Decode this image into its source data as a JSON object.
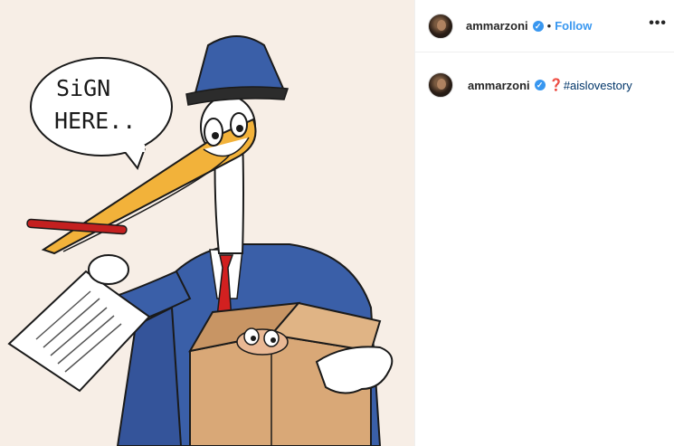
{
  "post": {
    "username": "ammarzoni",
    "follow_label": "Follow",
    "separator": "•",
    "more_label": "•••",
    "verified_glyph": "✓"
  },
  "caption": {
    "username": "ammarzoni",
    "emoji": "❓",
    "hashtag": "#aislovestory"
  },
  "illustration": {
    "speech_line1": "SiGN",
    "speech_line2": "HERE..",
    "icons": [
      "verified-badge-icon",
      "more-options-icon"
    ],
    "colors": {
      "background": "#f7eee6",
      "coat": "#3a5fa8",
      "beak": "#f2b23a",
      "tie": "#d22020",
      "box": "#d9a877",
      "accent": "#3897f0"
    }
  }
}
